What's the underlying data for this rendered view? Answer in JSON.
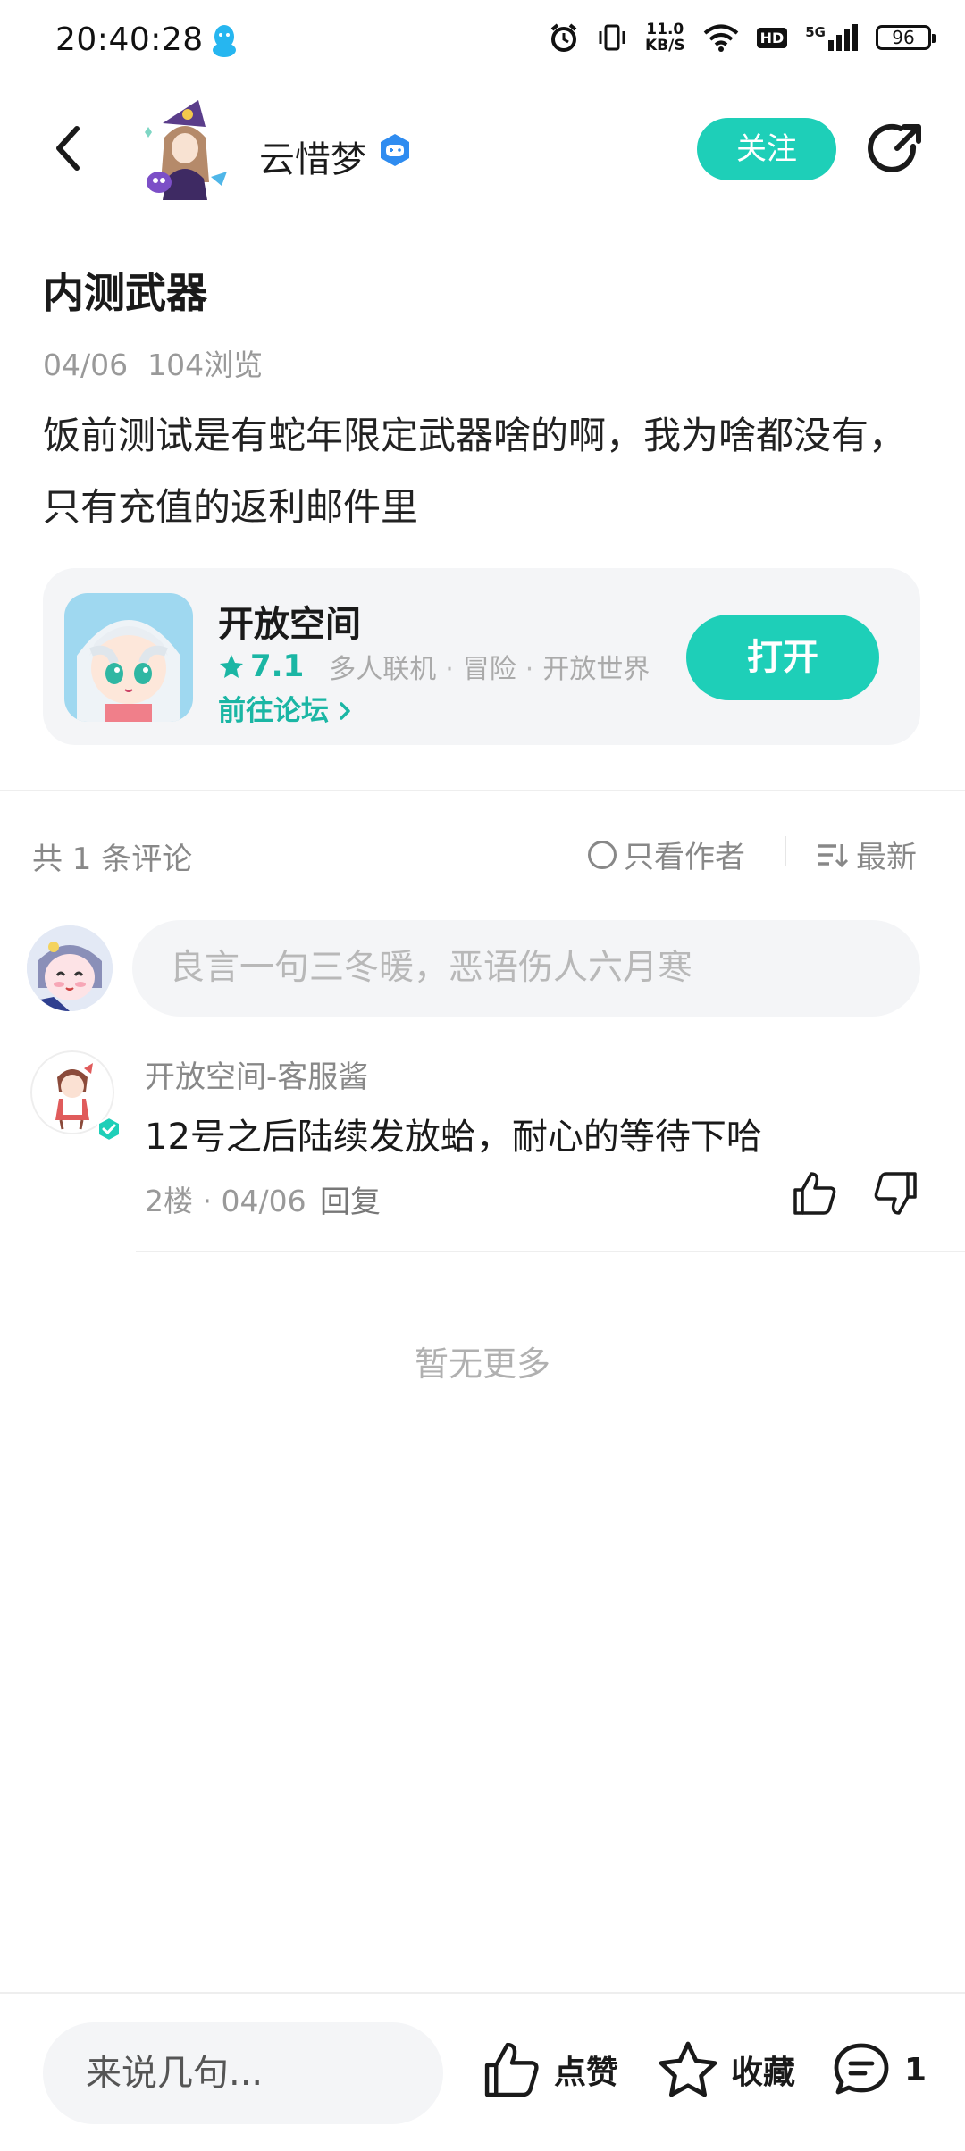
{
  "status_bar": {
    "time": "20:40:28",
    "net_speed_value": "11.0",
    "net_speed_unit": "KB/S",
    "hd": "HD",
    "network": "5G",
    "battery": "96"
  },
  "header": {
    "author_name": "云惜梦",
    "follow_label": "关注"
  },
  "post": {
    "title": "内测武器",
    "date": "04/06",
    "views": "104浏览",
    "body": "饭前测试是有蛇年限定武器啥的啊，我为啥都没有，只有充值的返利邮件里"
  },
  "game_card": {
    "name": "开放空间",
    "rating": "7.1",
    "tags": [
      "多人联机",
      "冒险",
      "开放世界"
    ],
    "forum_link": "前往论坛",
    "open_label": "打开"
  },
  "comments_header": {
    "count": "共 1 条评论",
    "author_only": "只看作者",
    "sort": "最新"
  },
  "comment_input": {
    "placeholder": "良言一句三冬暖，恶语伤人六月寒"
  },
  "comments": [
    {
      "user": "开放空间-客服酱",
      "text": "12号之后陆续发放蛤，耐心的等待下哈",
      "meta": "2楼 · 04/06",
      "reply": "回复"
    }
  ],
  "no_more": "暂无更多",
  "bottom_bar": {
    "input_placeholder": "来说几句...",
    "like_label": "点赞",
    "favorite_label": "收藏",
    "comment_count": "1"
  },
  "colors": {
    "accent": "#1ecfb8",
    "accent_text": "#1ab6a4",
    "verify_blue": "#2f8cf0"
  }
}
